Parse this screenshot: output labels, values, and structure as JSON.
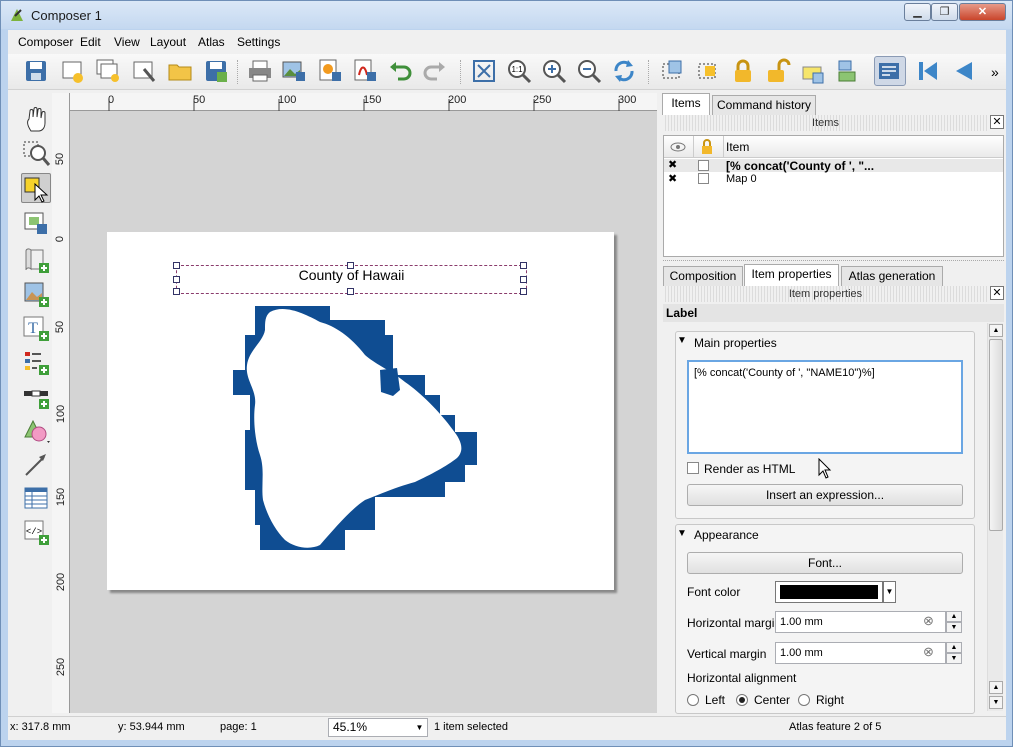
{
  "window": {
    "title": "Composer 1",
    "minimize": "▁",
    "restore": "❐",
    "close": "✕"
  },
  "menus": [
    "Composer",
    "Edit",
    "View",
    "Layout",
    "Atlas",
    "Settings"
  ],
  "toolbar_icons": [
    "save-icon",
    "new-composer-icon",
    "duplicate-composer-icon",
    "composer-manager-icon",
    "open-template-icon",
    "save-template-icon",
    "print-icon",
    "export-image-icon",
    "export-svg-icon",
    "export-pdf-icon",
    "undo-icon",
    "redo-icon",
    "zoom-full-icon",
    "zoom-100-icon",
    "zoom-in-icon",
    "zoom-out-icon",
    "refresh-icon",
    "select-all-icon",
    "deselect-icon",
    "lock-icon",
    "unlock-icon",
    "raise-icon",
    "align-icon",
    "atlas-preview-icon",
    "first-feature-icon",
    "previous-feature-icon"
  ],
  "toolbar_more": "»",
  "zoom_100_label": "1:1",
  "toolbox_icons": [
    "pan-icon",
    "zoom-tool-icon",
    "select-move-icon",
    "move-content-icon",
    "add-map-icon",
    "add-image-icon",
    "add-label-icon",
    "add-legend-icon",
    "add-scalebar-icon",
    "add-shape-icon",
    "add-arrow-icon",
    "add-table-icon",
    "add-html-icon"
  ],
  "label_tool_glyph": "T",
  "html_tool_glyph": "</>",
  "ruler": {
    "top": [
      "0",
      "50",
      "100",
      "150",
      "200",
      "250",
      "300"
    ],
    "left": [
      "50",
      "0",
      "50",
      "100",
      "150",
      "200",
      "250"
    ]
  },
  "canvas": {
    "label_text": "County of Hawaii",
    "map_color": "#0f4d92"
  },
  "panel": {
    "top_tabs": [
      "Items",
      "Command history"
    ],
    "items_header": "Items",
    "close_glyph": "✕",
    "list_column": "Item",
    "items": [
      {
        "name": "[% concat('County of ', \"...",
        "bold": true
      },
      {
        "name": "Map 0",
        "bold": false
      }
    ],
    "visible_mark": "✖",
    "bottom_tabs": [
      "Composition",
      "Item properties",
      "Atlas generation"
    ],
    "props_header": "Item properties",
    "item_type": "Label",
    "main_group": "Main properties",
    "expression": "[% concat('County of ', \"NAME10\")%]",
    "render_html": "Render as HTML",
    "insert_expr": "Insert an expression...",
    "appearance_group": "Appearance",
    "font_btn": "Font...",
    "font_color_label": "Font color",
    "font_color": "#000000",
    "hmargin_label": "Horizontal margin",
    "hmargin": "1.00 mm",
    "vmargin_label": "Vertical margin",
    "vmargin": "1.00 mm",
    "halign_label": "Horizontal alignment",
    "align_options": [
      "Left",
      "Center",
      "Right"
    ],
    "align_selected": "Center",
    "spin_up": "▲",
    "spin_down": "▼",
    "clear_glyph": "⊗",
    "combo_arrow": "▼",
    "collapse_arrow": "▼"
  },
  "status": {
    "x": "x: 317.8 mm",
    "y": "y: 53.944 mm",
    "page": "page: 1",
    "zoom": "45.1%",
    "selected": "1 item selected",
    "atlas": "Atlas feature 2 of 5"
  }
}
